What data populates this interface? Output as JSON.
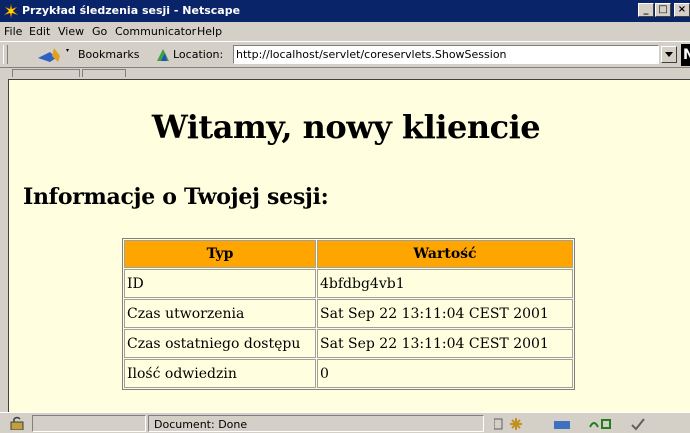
{
  "window": {
    "title": "Przykład śledzenia sesji - Netscape",
    "minimize": "_",
    "maximize": "□",
    "close": "×"
  },
  "menu": {
    "items": [
      "File",
      "Edit",
      "View",
      "Go",
      "Communicator",
      "Help"
    ]
  },
  "toolbar": {
    "bookmarks_label": "Bookmarks",
    "location_label": "Location:",
    "location_value": "http://localhost/servlet/coreservlets.ShowSession",
    "logo": "N"
  },
  "page": {
    "heading": "Witamy, nowy kliencie",
    "subheading": "Informacje o Twojej sesji:",
    "table": {
      "headers": [
        "Typ",
        "Wartość"
      ],
      "rows": [
        [
          "ID",
          "4bfdbg4vb1"
        ],
        [
          "Czas utworzenia",
          "Sat Sep 22 13:11:04 CEST 2001"
        ],
        [
          "Czas ostatniego dostępu",
          "Sat Sep 22 13:11:04 CEST 2001"
        ],
        [
          "Ilość odwiedzin",
          "0"
        ]
      ]
    },
    "colors": {
      "header_bg": "#ffa500",
      "page_bg": "#ffffe0"
    }
  },
  "status": {
    "text": "Document: Done"
  },
  "icons": [
    "netscape-icon",
    "bookmarks-icon",
    "location-icon",
    "lock-icon",
    "component-icons"
  ]
}
